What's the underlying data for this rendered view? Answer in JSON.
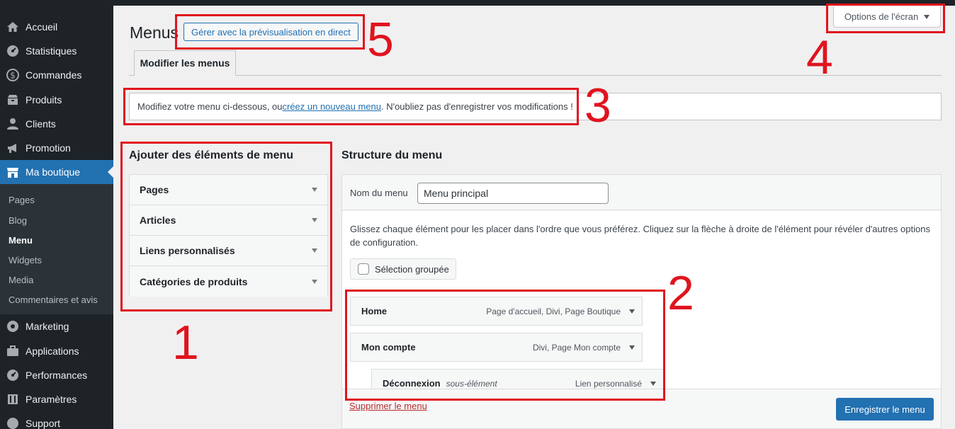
{
  "sidebar": {
    "items": [
      {
        "label": "Accueil",
        "icon": "home-icon"
      },
      {
        "label": "Statistiques",
        "icon": "dashboard-icon"
      },
      {
        "label": "Commandes",
        "icon": "dollar-icon"
      },
      {
        "label": "Produits",
        "icon": "archive-icon"
      },
      {
        "label": "Clients",
        "icon": "user-icon"
      },
      {
        "label": "Promotion",
        "icon": "megaphone-icon"
      },
      {
        "label": "Ma boutique",
        "icon": "store-icon"
      }
    ],
    "submenu": [
      "Pages",
      "Blog",
      "Menu",
      "Widgets",
      "Media",
      "Commentaires et avis"
    ],
    "bottom_items": [
      {
        "label": "Marketing",
        "icon": "gauge-icon"
      },
      {
        "label": "Applications",
        "icon": "briefcase-icon"
      },
      {
        "label": "Performances",
        "icon": "dashboard-icon"
      },
      {
        "label": "Paramètres",
        "icon": "settings-icon"
      },
      {
        "label": "Support",
        "icon": "help-icon"
      }
    ]
  },
  "header": {
    "title": "Menus",
    "live_preview_button": "Gérer avec la prévisualisation en direct",
    "screen_options": "Options de l'écran"
  },
  "tabs": [
    {
      "label": "Modifier les menus"
    }
  ],
  "notice": {
    "before": "Modifiez votre menu ci-dessous, ou ",
    "link": "créez un nouveau menu",
    "after": ". N'oubliez pas d'enregistrer vos modifications !"
  },
  "add_items": {
    "title": "Ajouter des éléments de menu",
    "sections": [
      "Pages",
      "Articles",
      "Liens personnalisés",
      "Catégories de produits"
    ]
  },
  "structure": {
    "title": "Structure du menu",
    "menu_name_label": "Nom du menu",
    "menu_name_value": "Menu principal",
    "instructions": "Glissez chaque élément pour les placer dans l'ordre que vous préférez. Cliquez sur la flèche à droite de l'élément pour révéler d'autres options de configuration.",
    "bulk_select": "Sélection groupée",
    "items": [
      {
        "title": "Home",
        "sub": "",
        "type": "Page d'accueil, Divi, Page Boutique"
      },
      {
        "title": "Mon compte",
        "sub": "",
        "type": "Divi, Page Mon compte"
      },
      {
        "title": "Déconnexion",
        "sub": "sous-élément",
        "type": "Lien personnalisé"
      }
    ],
    "delete_link": "Supprimer le menu",
    "save_button": "Enregistrer le menu"
  },
  "annotations": [
    "1",
    "2",
    "3",
    "4",
    "5"
  ],
  "colors": {
    "annotation": "#e0141e",
    "accent": "#2271b1",
    "sidebar_bg": "#1d2327",
    "delete": "#b32d2e"
  }
}
